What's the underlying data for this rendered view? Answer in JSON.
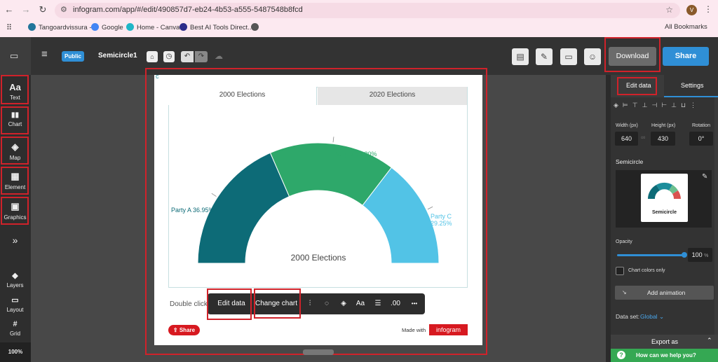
{
  "browser": {
    "url": "infogram.com/app/#/edit/490857d7-eb24-4b53-a555-5487548b8fcd",
    "avatar_letter": "V",
    "bookmarks": [
      "Tangoardvissura -",
      "Google",
      "Home - Canva",
      "Best AI Tools Direct..."
    ],
    "all_bookmarks": "All Bookmarks"
  },
  "topbar": {
    "badge": "Public",
    "project_title": "Semicircle1",
    "download": "Download",
    "share": "Share"
  },
  "left_sidebar": {
    "items": [
      {
        "label": "Text",
        "glyph": "Aa"
      },
      {
        "label": "Chart",
        "glyph": "▮▮"
      },
      {
        "label": "Map",
        "glyph": "◈"
      },
      {
        "label": "Element",
        "glyph": "▦"
      },
      {
        "label": "Graphics",
        "glyph": "▣"
      }
    ],
    "more": "»",
    "bottom": [
      {
        "label": "Layers",
        "glyph": "◆"
      },
      {
        "label": "Layout",
        "glyph": "▭"
      },
      {
        "label": "Grid",
        "glyph": "#"
      }
    ],
    "zoom": "100%"
  },
  "chart": {
    "tabs": [
      "2000 Elections",
      "2020 Elections"
    ],
    "active_tab": 0,
    "hint": "Double click to",
    "made_with": "Made with",
    "brand": "infogram",
    "share_pill": "Share"
  },
  "chart_data": {
    "type": "pie",
    "variant": "semicircle",
    "center_label": "2000 Elections",
    "slices": [
      {
        "name": "Party A",
        "value": 36.95,
        "label": "Party A 36.95%",
        "color": "#0d6b77"
      },
      {
        "name": "Party B",
        "value": 33.8,
        "label": "Party B 33.80%",
        "color": "#2ea86a"
      },
      {
        "name": "Party C",
        "value": 29.25,
        "label_lines": [
          "Party C",
          "29.25%"
        ],
        "color": "#52c3e6"
      }
    ]
  },
  "floating_toolbar": {
    "edit_data": "Edit data",
    "change_chart": "Change chart",
    "decimals": ".00",
    "more": "•••",
    "font": "Aa"
  },
  "right_panel": {
    "tabs": [
      "Edit data",
      "Settings"
    ],
    "width_label": "Width (px)",
    "height_label": "Height (px)",
    "rotation_label": "Rotation",
    "width": "640",
    "height": "430",
    "rotation": "0°",
    "section_title": "Semicircle",
    "thumb_caption": "Semicircle",
    "opacity_label": "Opacity",
    "opacity": "100",
    "opacity_unit": "%",
    "chart_colors_only": "Chart colors only",
    "add_animation": "Add animation",
    "dataset_label": "Data set:",
    "dataset_value": "Global",
    "export_as": "Export as",
    "help": "How can we help you?"
  },
  "colors": {
    "accent_blue": "#2f8fd6",
    "highlight_red": "#d0222a",
    "help_green": "#35a853",
    "brand_red": "#d71920"
  }
}
